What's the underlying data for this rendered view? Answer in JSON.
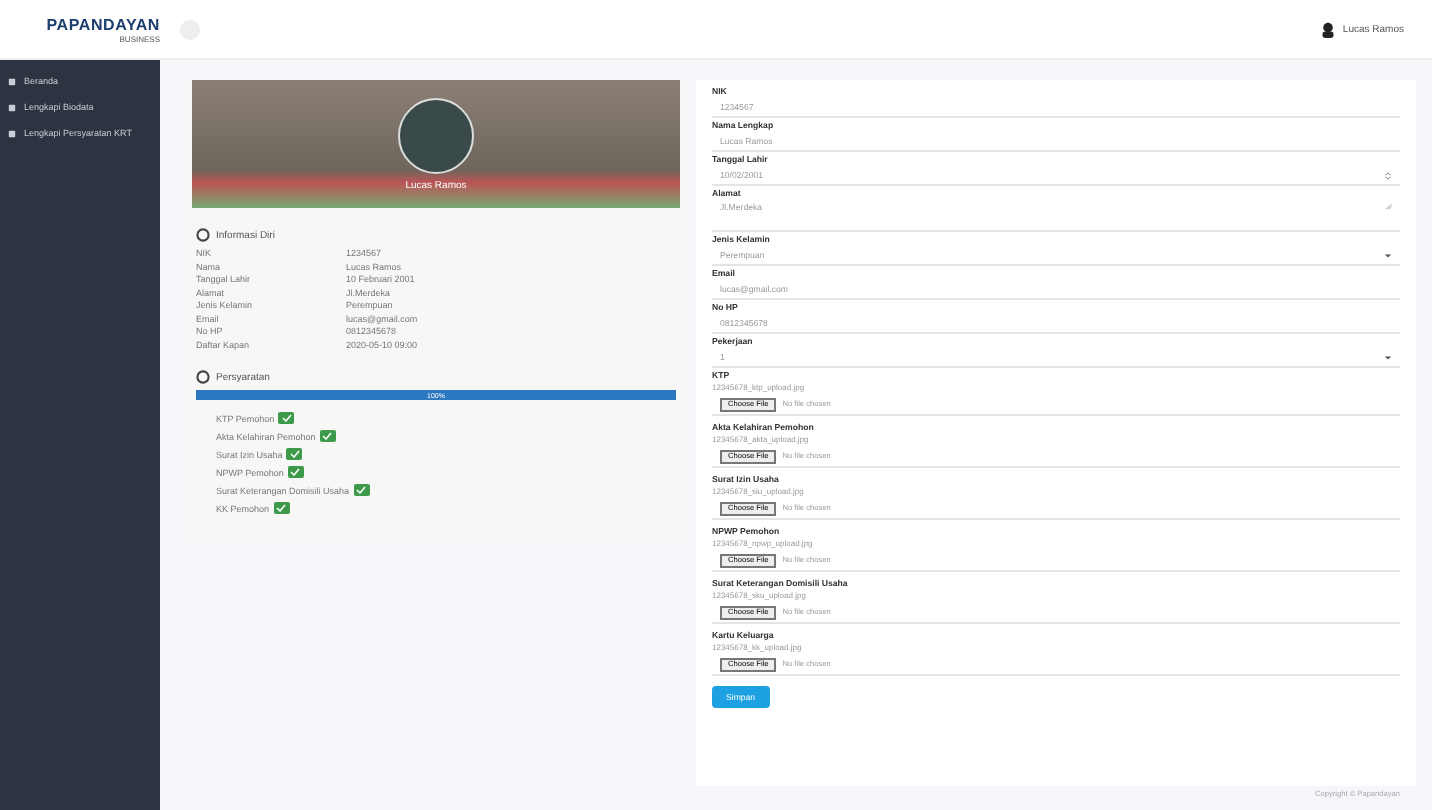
{
  "header": {
    "logo": "PAPANDAYAN",
    "logo_sub": "BUSINESS",
    "user_name": "Lucas Ramos"
  },
  "sidebar": {
    "items": [
      {
        "label": "Beranda",
        "selected": false
      },
      {
        "label": "Lengkapi Biodata",
        "selected": false
      },
      {
        "label": "Lengkapi Persyaratan KRT",
        "selected": false
      }
    ]
  },
  "profile": {
    "name": "Lucas Ramos",
    "info_title": "Informasi Diri",
    "info": [
      {
        "key": "NIK",
        "value": "1234567"
      },
      {
        "key": "Nama",
        "value": "Lucas Ramos"
      },
      {
        "key": "Tanggal Lahir",
        "value": "10 Februari 2001"
      },
      {
        "key": "Alamat",
        "value": "Jl.Merdeka"
      },
      {
        "key": "Jenis Kelamin",
        "value": "Perempuan"
      },
      {
        "key": "Email",
        "value": "lucas@gmail.com"
      },
      {
        "key": "No HP",
        "value": "0812345678"
      },
      {
        "key": "Daftar Kapan",
        "value": "2020-05-10 09:00"
      }
    ],
    "req_title": "Persyaratan",
    "progress": {
      "level": 1,
      "reading": "100%"
    },
    "requirements": [
      {
        "label": "KTP Pemohon",
        "done": true
      },
      {
        "label": "Akta Kelahiran Pemohon",
        "done": true
      },
      {
        "label": "Surat Izin Usaha",
        "done": true
      },
      {
        "label": "NPWP Pemohon",
        "done": true
      },
      {
        "label": "Surat Keterangan Domisili Usaha",
        "done": true
      },
      {
        "label": "KK Pemohon",
        "done": true
      }
    ]
  },
  "form": {
    "fields": [
      {
        "kind": "text",
        "label": "NIK",
        "value": "1234567"
      },
      {
        "kind": "text",
        "label": "Nama Lengkap",
        "value": "Lucas Ramos"
      },
      {
        "kind": "date",
        "label": "Tanggal Lahir",
        "value": "10/02/2001"
      },
      {
        "kind": "textarea",
        "label": "Alamat",
        "value": "Jl.Merdeka"
      },
      {
        "kind": "select",
        "label": "Jenis Kelamin",
        "value": "Perempuan"
      },
      {
        "kind": "text",
        "label": "Email",
        "value": "lucas@gmail.com"
      },
      {
        "kind": "text",
        "label": "No HP",
        "value": "0812345678"
      },
      {
        "kind": "select",
        "label": "Pekerjaan",
        "value": "1"
      }
    ],
    "uploads": [
      {
        "label": "KTP",
        "link": "12345678_ktp_upload.jpg",
        "button": "Choose File",
        "status": "No file chosen"
      },
      {
        "label": "Akta Kelahiran Pemohon",
        "link": "12345678_akta_upload.jpg",
        "button": "Choose File",
        "status": "No file chosen"
      },
      {
        "label": "Surat Izin Usaha",
        "link": "12345678_siu_upload.jpg",
        "button": "Choose File",
        "status": "No file chosen"
      },
      {
        "label": "NPWP Pemohon",
        "link": "12345678_npwp_upload.jpg",
        "button": "Choose File",
        "status": "No file chosen"
      },
      {
        "label": "Surat Keterangan Domisili Usaha",
        "link": "12345678_sku_upload.jpg",
        "button": "Choose File",
        "status": "No file chosen"
      },
      {
        "label": "Kartu Keluarga",
        "link": "12345678_kk_upload.jpg",
        "button": "Choose File",
        "status": "No file chosen"
      }
    ],
    "submit": "Simpan"
  },
  "footer": "Copyright © Papandayan"
}
